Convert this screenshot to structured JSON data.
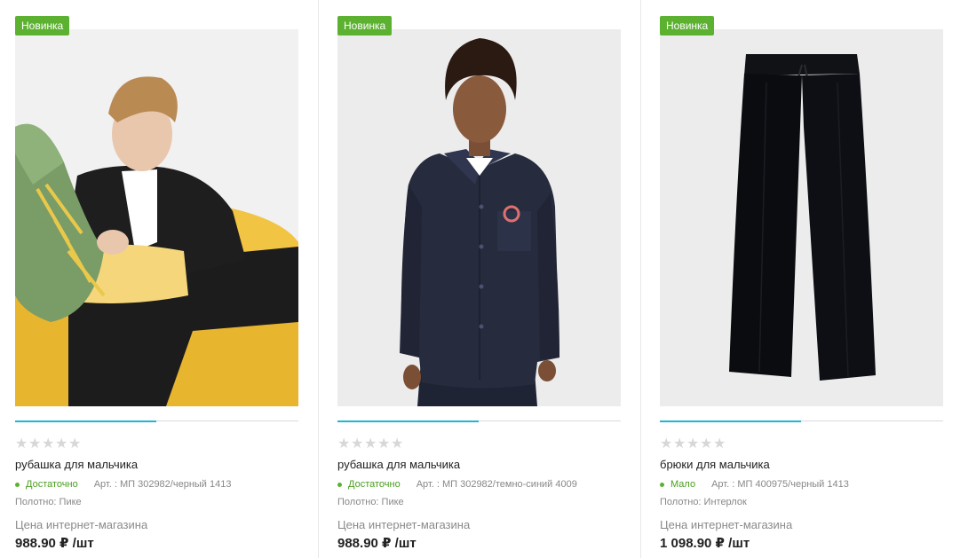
{
  "products": [
    {
      "badge": "Новинка",
      "rating_stars": 5,
      "rating_value": 0,
      "title": "рубашка для мальчика",
      "stock": "Достаточно",
      "article": "Арт. : МП 302982/черный 1413",
      "fabric": "Полотно: Пике",
      "price_label": "Цена интернет-магазина",
      "price": "988.90 ₽ /шт",
      "image": "boy-black-shirt-beanbag"
    },
    {
      "badge": "Новинка",
      "rating_stars": 5,
      "rating_value": 0,
      "title": "рубашка для мальчика",
      "stock": "Достаточно",
      "article": "Арт. : МП 302982/темно-синий 4009",
      "fabric": "Полотно: Пике",
      "price_label": "Цена интернет-магазина",
      "price": "988.90 ₽ /шт",
      "image": "boy-navy-shirt-standing"
    },
    {
      "badge": "Новинка",
      "rating_stars": 5,
      "rating_value": 0,
      "title": "брюки для мальчика",
      "stock": "Мало",
      "article": "Арт. : МП 400975/черный 1413",
      "fabric": "Полотно: Интерлок",
      "price_label": "Цена интернет-магазина",
      "price": "1 098.90 ₽ /шт",
      "image": "black-trousers-flat"
    }
  ],
  "colors": {
    "badge": "#5cb230",
    "stock": "#4a9e1f",
    "slider_active": "#21b4d4",
    "star_empty": "#d7d7d7"
  }
}
